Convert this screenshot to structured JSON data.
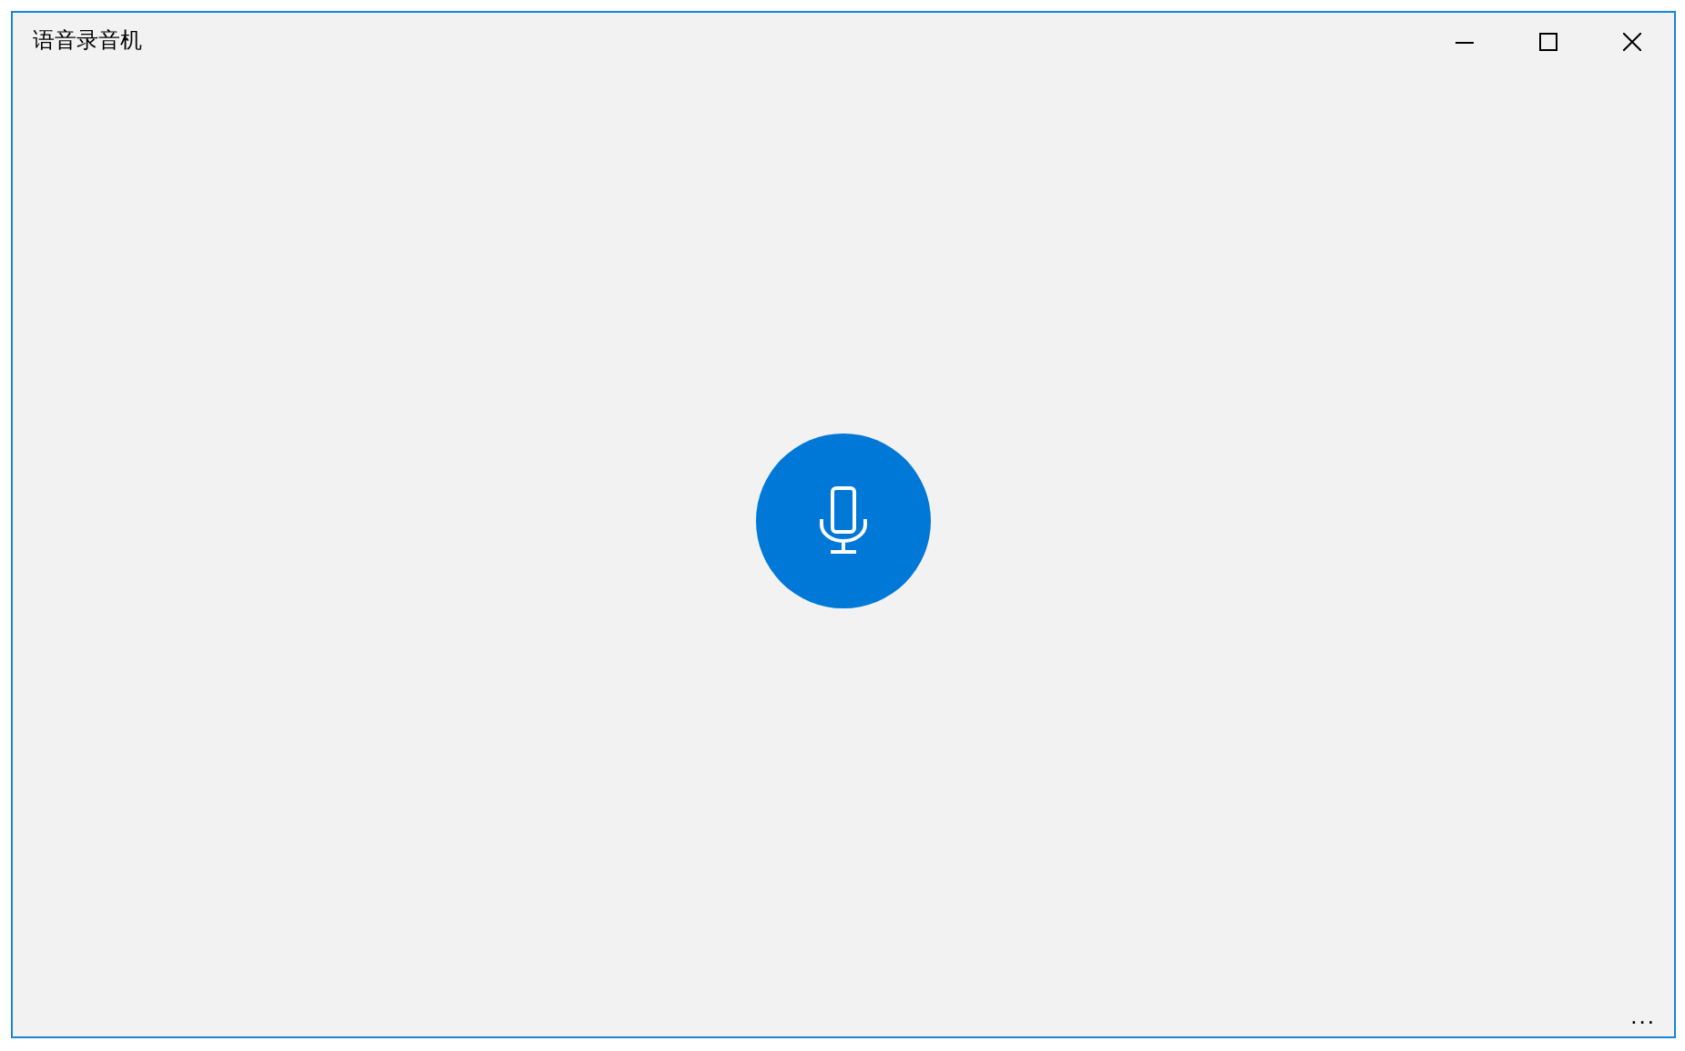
{
  "window": {
    "title": "语音录音机"
  },
  "record_button": {
    "kind": "microphone"
  },
  "more_button": {
    "label": "..."
  }
}
